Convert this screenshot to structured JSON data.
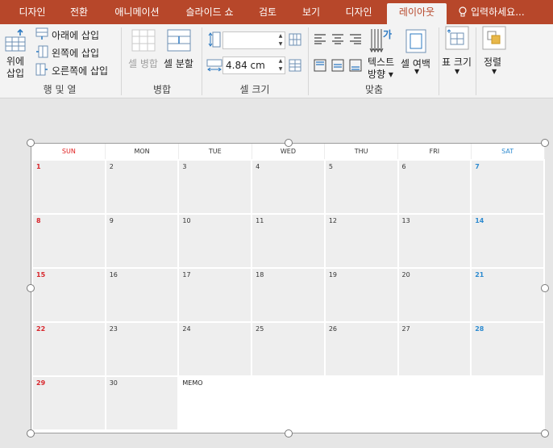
{
  "tabs": [
    {
      "label": "디자인"
    },
    {
      "label": "전환"
    },
    {
      "label": "애니메이션"
    },
    {
      "label": "슬라이드 쇼"
    },
    {
      "label": "검토"
    },
    {
      "label": "보기"
    },
    {
      "label": "디자인"
    },
    {
      "label": "레이아웃"
    }
  ],
  "tell_me": "입력하세요...",
  "ribbon": {
    "rows_cols": {
      "insert_above": "위에\n삽입",
      "insert_below": "아래에 삽입",
      "insert_left": "왼쪽에 삽입",
      "insert_right": "오른쪽에 삽입",
      "label": "행 및 열"
    },
    "merge": {
      "merge_cells": "셀 병합",
      "split_cells": "셀 분할",
      "label": "병합"
    },
    "cell_size": {
      "height_value": "",
      "width_value": "4.84 cm",
      "label": "셀 크기"
    },
    "alignment": {
      "text_direction_1": "텍스트",
      "text_direction_2": "방향",
      "cell_margins": "셀 여백",
      "label": "맞춤"
    },
    "table_size": {
      "label": "표 크기"
    },
    "arrange": {
      "label": "정렬"
    }
  },
  "calendar": {
    "days": [
      "SUN",
      "MON",
      "TUE",
      "WED",
      "THU",
      "FRI",
      "SAT"
    ],
    "weeks": [
      [
        "1",
        "2",
        "3",
        "4",
        "5",
        "6",
        "7"
      ],
      [
        "8",
        "9",
        "10",
        "11",
        "12",
        "13",
        "14"
      ],
      [
        "15",
        "16",
        "17",
        "18",
        "19",
        "20",
        "21"
      ],
      [
        "22",
        "23",
        "24",
        "25",
        "26",
        "27",
        "28"
      ],
      [
        "29",
        "30"
      ]
    ],
    "memo_label": "MEMO"
  },
  "colors": {
    "accent": "#b7472a",
    "sunday": "#d8262c",
    "saturday": "#2e8bd0"
  }
}
